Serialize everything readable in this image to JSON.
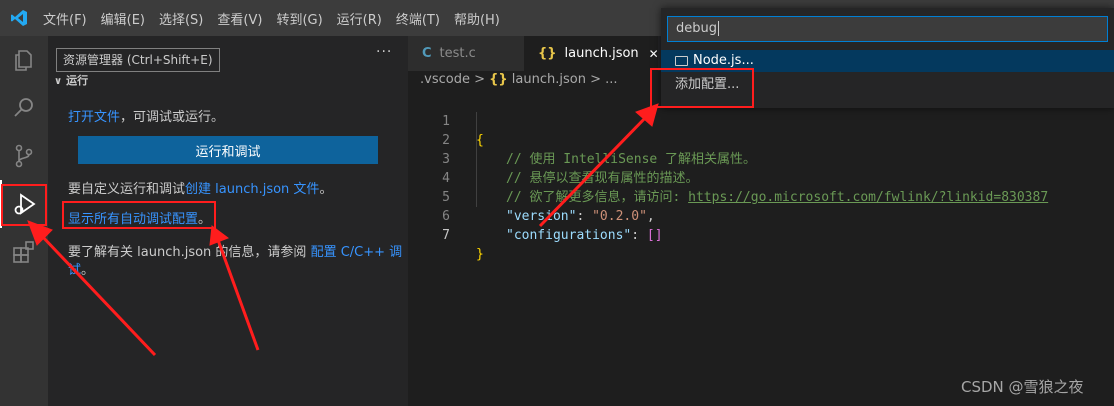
{
  "titlebar": {
    "menu": [
      {
        "name": "menu-file",
        "label": "文件(F)"
      },
      {
        "name": "menu-edit",
        "label": "编辑(E)"
      },
      {
        "name": "menu-selection",
        "label": "选择(S)"
      },
      {
        "name": "menu-view",
        "label": "查看(V)"
      },
      {
        "name": "menu-goto",
        "label": "转到(G)"
      },
      {
        "name": "menu-run",
        "label": "运行(R)"
      },
      {
        "name": "menu-terminal",
        "label": "终端(T)"
      },
      {
        "name": "menu-help",
        "label": "帮助(H)"
      }
    ]
  },
  "activity_bar": {
    "items": [
      "explorer-icon",
      "search-icon",
      "source-control-icon",
      "run-debug-icon",
      "extensions-icon"
    ],
    "active": "run-debug-icon"
  },
  "sidebar": {
    "tooltip": "资源管理器 (Ctrl+Shift+E)",
    "more": "···",
    "section_title": "运行",
    "open_file_link": "打开文件",
    "open_file_rest": "，可调试或运行。",
    "run_button": "运行和调试",
    "customize_text": "要自定义运行和调试",
    "create_launch_link": "创建 launch.json 文件",
    "customize_end": "。",
    "show_all_link": "显示所有自动调试配置",
    "show_all_end": "。",
    "learn_text": "要了解有关 launch.json 的信息，请参阅",
    "config_link_1": "配置 C/C++ 调",
    "config_link_2": "试",
    "learn_end": "。"
  },
  "tabs": [
    {
      "icon": "C",
      "label": "test.c",
      "active": false
    },
    {
      "icon": "{}",
      "label": "launch.json",
      "active": true,
      "close": "✕"
    }
  ],
  "breadcrumb": {
    "folder": ".vscode",
    "sep": ">",
    "icon": "{}",
    "file": "launch.json",
    "more": "..."
  },
  "code": {
    "line_numbers": [
      "1",
      "2",
      "3",
      "4",
      "5",
      "6",
      "7"
    ],
    "open_brace": "{",
    "comment_1": "// 使用 IntelliSense 了解相关属性。",
    "comment_2": "// 悬停以查看现有属性的描述。",
    "comment_3_prefix": "// 欲了解更多信息，请访问: ",
    "comment_3_url": "https://go.microsoft.com/fwlink/?linkid=830387",
    "version_key": "\"version\"",
    "version_val": "\"0.2.0\"",
    "configs_key": "\"configurations\"",
    "configs_val": "[]",
    "close_brace": "}",
    "colon": ": ",
    "comma": ","
  },
  "quick_pick": {
    "input_value": "debug",
    "items": [
      {
        "icon": "folder-icon",
        "label": "Node.js..."
      },
      {
        "label": "添加配置..."
      }
    ],
    "selected_index": 0
  },
  "watermark": "CSDN @雪狼之夜",
  "colors": {
    "accent": "#0e639c",
    "annotation": "#ff1d1d",
    "link": "#3794ff"
  }
}
